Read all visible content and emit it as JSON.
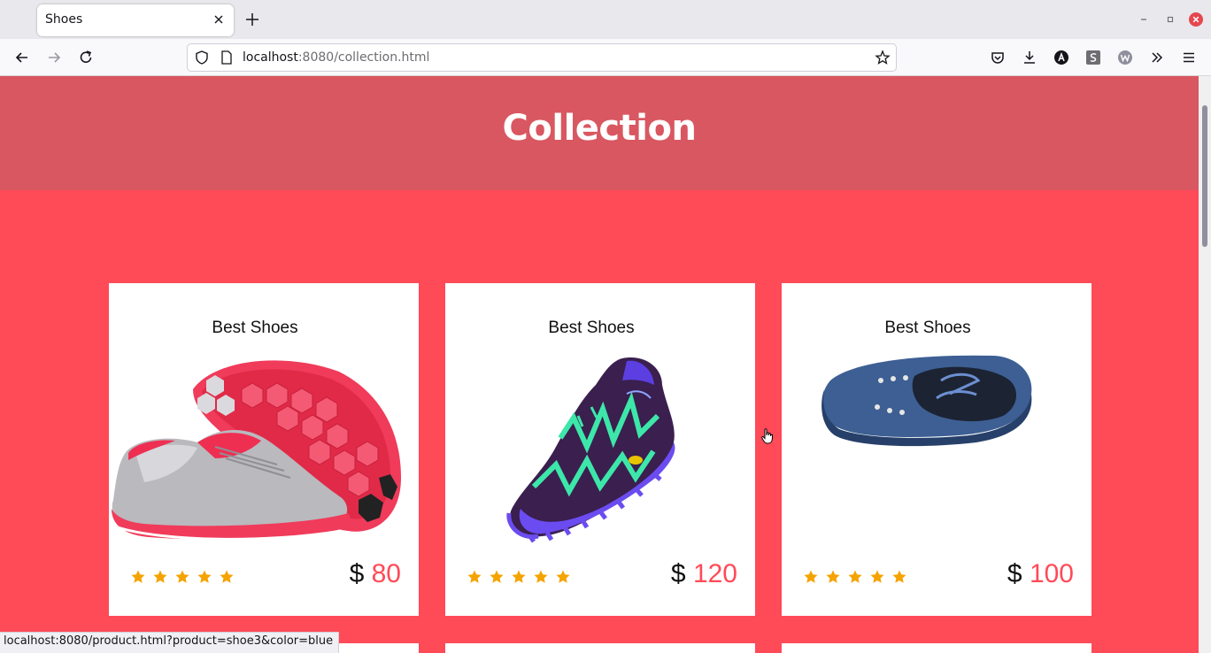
{
  "browser": {
    "tab_title": "Shoes",
    "url_host": "localhost",
    "url_rest": ":8080/collection.html",
    "status_url": "localhost:8080/product.html?product=shoe3&color=blue"
  },
  "page": {
    "title": "Collection",
    "accent_color": "#ff4a58",
    "hero_color": "#d95761",
    "star_color": "#f5a300"
  },
  "products": [
    {
      "name": "Best Shoes",
      "currency": "$",
      "price": "80",
      "rating": 5,
      "image": "pink-gray-sneaker"
    },
    {
      "name": "Best Shoes",
      "currency": "$",
      "price": "120",
      "rating": 5,
      "image": "purple-green-trail-shoe"
    },
    {
      "name": "Best Shoes",
      "currency": "$",
      "price": "100",
      "rating": 5,
      "image": "blue-canvas-shoe"
    }
  ]
}
